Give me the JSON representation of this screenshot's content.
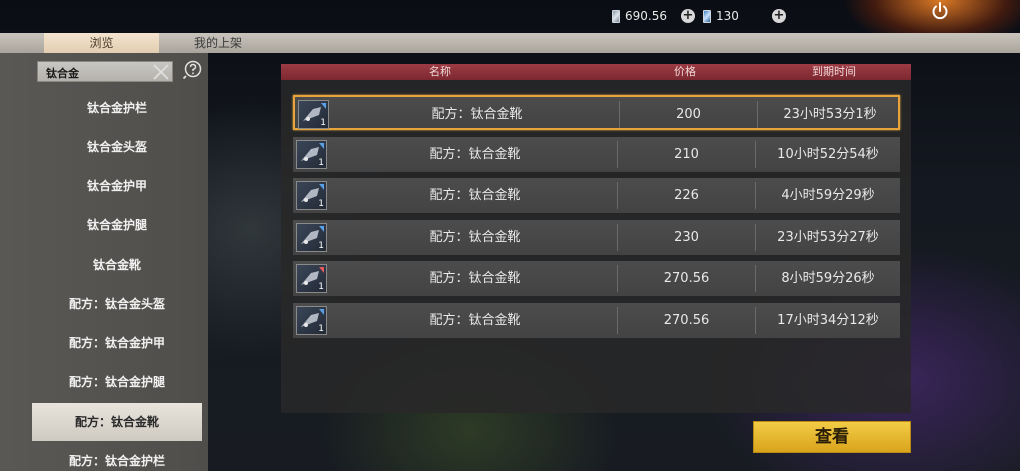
{
  "currency": {
    "silver": "690.56",
    "tickets": "130",
    "silver_icon": "silver-coin-icon",
    "ticket_icon": "ticket-card-icon"
  },
  "tabs": {
    "browse": "浏览",
    "mine": "我的上架"
  },
  "search": {
    "value": "钛合金"
  },
  "sidebar": {
    "items": [
      {
        "label": "钛合金护栏"
      },
      {
        "label": "钛合金头盔"
      },
      {
        "label": "钛合金护甲"
      },
      {
        "label": "钛合金护腿"
      },
      {
        "label": "钛合金靴"
      },
      {
        "label": "配方：钛合金头盔"
      },
      {
        "label": "配方：钛合金护甲"
      },
      {
        "label": "配方：钛合金护腿"
      },
      {
        "label": "配方：钛合金靴"
      },
      {
        "label": "配方：钛合金护栏"
      }
    ],
    "selected_index": 8
  },
  "table": {
    "headers": {
      "name": "名称",
      "price": "价格",
      "expire": "到期时间"
    },
    "rows": [
      {
        "qty": "1",
        "name": "配方：钛合金靴",
        "price": "200",
        "expire": "23小时53分1秒"
      },
      {
        "qty": "1",
        "name": "配方：钛合金靴",
        "price": "210",
        "expire": "10小时52分54秒"
      },
      {
        "qty": "1",
        "name": "配方：钛合金靴",
        "price": "226",
        "expire": "4小时59分29秒"
      },
      {
        "qty": "1",
        "name": "配方：钛合金靴",
        "price": "230",
        "expire": "23小时53分27秒"
      },
      {
        "qty": "1",
        "name": "配方：钛合金靴",
        "price": "270.56",
        "expire": "8小时59分26秒"
      },
      {
        "qty": "1",
        "name": "配方：钛合金靴",
        "price": "270.56",
        "expire": "17小时34分12秒"
      }
    ],
    "selected_index": 0
  },
  "buttons": {
    "view": "查看"
  },
  "colors": {
    "accent_gold": "#e6a43a",
    "header_red": "#8c3038",
    "button_yellow": "#e8b830"
  }
}
